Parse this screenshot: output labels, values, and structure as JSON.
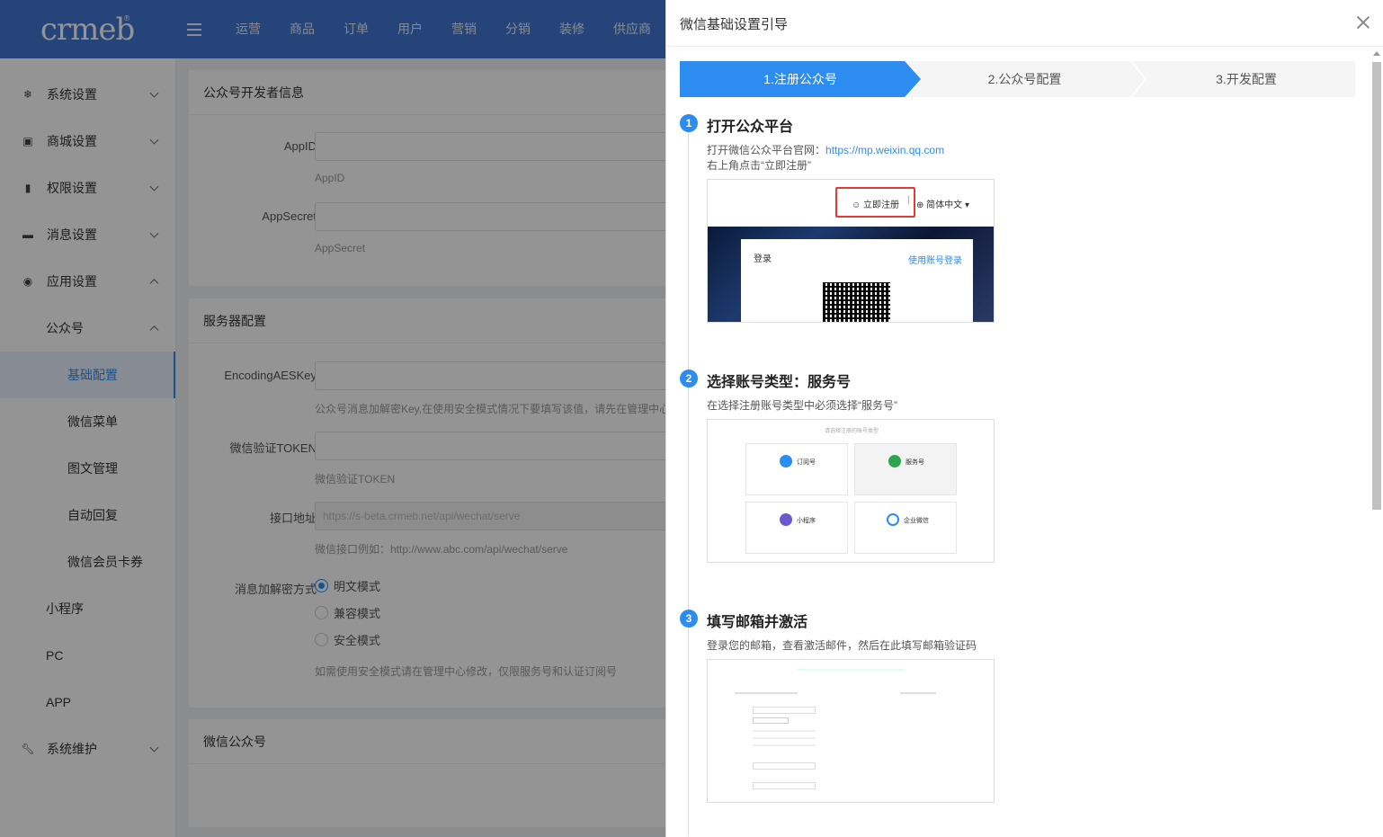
{
  "header": {
    "logo": "crmeb",
    "nav": [
      "运营",
      "商品",
      "订单",
      "用户",
      "营销",
      "分销",
      "装修",
      "供应商"
    ]
  },
  "sidebar": {
    "items": [
      {
        "label": "系统设置",
        "icon": "gear-icon"
      },
      {
        "label": "商城设置",
        "icon": "shop-icon"
      },
      {
        "label": "权限设置",
        "icon": "bookmark-icon"
      },
      {
        "label": "消息设置",
        "icon": "message-icon"
      },
      {
        "label": "应用设置",
        "icon": "app-icon"
      },
      {
        "label": "公众号"
      },
      {
        "label": "基础配置"
      },
      {
        "label": "微信菜单"
      },
      {
        "label": "图文管理"
      },
      {
        "label": "自动回复"
      },
      {
        "label": "微信会员卡券"
      },
      {
        "label": "小程序"
      },
      {
        "label": "PC"
      },
      {
        "label": "APP"
      },
      {
        "label": "系统维护",
        "icon": "wrench-icon"
      }
    ]
  },
  "main": {
    "card1": {
      "title": "公众号开发者信息",
      "appid_label": "AppID",
      "appid_hint": "AppID",
      "appsecret_label": "AppSecret",
      "appsecret_hint": "AppSecret"
    },
    "card2": {
      "title": "服务器配置",
      "aeskey_label": "EncodingAESKey",
      "aeskey_hint": "公众号消息加解密Key,在使用安全模式情况下要填写该值，请先在管理中心",
      "token_label": "微信验证TOKEN",
      "token_hint": "微信验证TOKEN",
      "api_label": "接口地址",
      "api_value": "https://s-beta.crmeb.net/api/wechat/serve",
      "api_hint": "微信接口例如：http://www.abc.com/api/wechat/serve",
      "mode_label": "消息加解密方式",
      "modes": [
        "明文模式",
        "兼容模式",
        "安全模式"
      ],
      "mode_hint": "如需使用安全模式请在管理中心修改，仅限服务号和认证订阅号"
    },
    "card3": {
      "title": "微信公众号"
    }
  },
  "drawer": {
    "title": "微信基础设置引导",
    "steps": [
      "1.注册公众号",
      "2.公众号配置",
      "3.开发配置"
    ],
    "sections": [
      {
        "num": "1",
        "title": "打开公众平台",
        "text1": "打开微信公众平台官网：",
        "link": "https://mp.weixin.qq.com",
        "text2": "右上角点击“立即注册”",
        "shot": {
          "register": "立即注册",
          "lang": "简体中文",
          "login": "登录",
          "account_login": "使用账号登录"
        }
      },
      {
        "num": "2",
        "title": "选择账号类型：服务号",
        "text1": "在选择注册账号类型中必须选择“服务号”",
        "shot": {
          "header": "请选择注册的账号类型",
          "types": [
            "订阅号",
            "服务号",
            "小程序",
            "企业微信"
          ]
        }
      },
      {
        "num": "3",
        "title": "填写邮箱并激活",
        "text1": "登录您的邮箱，查看激活邮件，然后在此填写邮箱验证码"
      }
    ]
  }
}
